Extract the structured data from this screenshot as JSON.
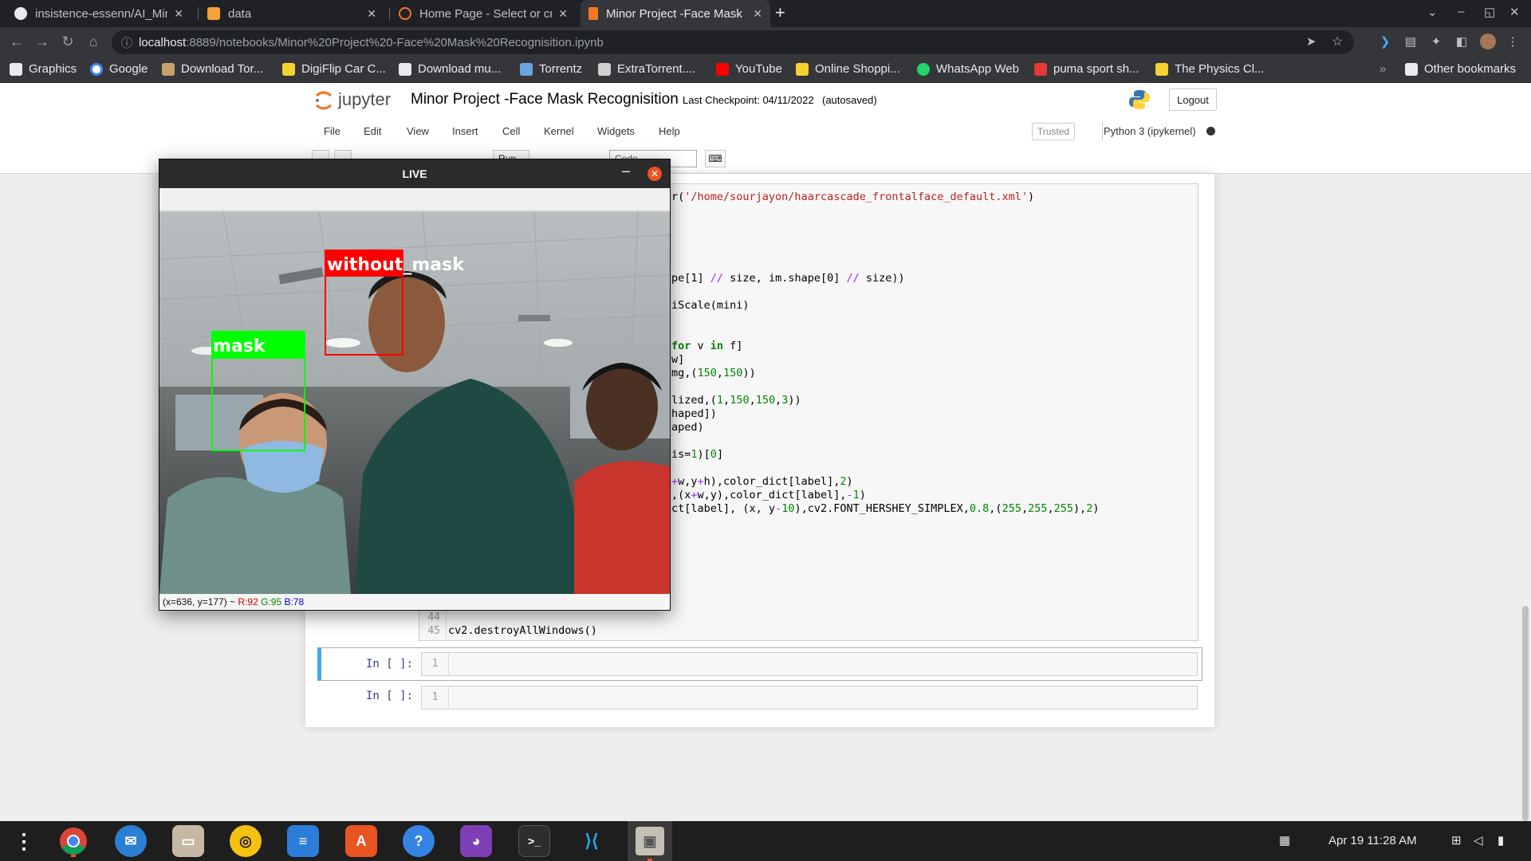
{
  "browser": {
    "tabs": [
      {
        "title": "insistence-essenn/AI_Min",
        "close": "✕"
      },
      {
        "title": "data",
        "close": "✕"
      },
      {
        "title": "Home Page - Select or cre",
        "close": "✕"
      },
      {
        "title": "Minor Project -Face Mask",
        "close": "✕",
        "active": true
      }
    ],
    "new_tab_label": "+",
    "url_host": "localhost",
    "url_path": ":8889/notebooks/Minor%20Project%20-Face%20Mask%20Recognisition.ipynb",
    "bookmarks": [
      {
        "label": "Graphics",
        "icon": "folder-icon"
      },
      {
        "label": "Google",
        "icon": "google-icon"
      },
      {
        "label": "Download Tor...",
        "icon": "shield-icon"
      },
      {
        "label": "DigiFlip Car C...",
        "icon": "bookmark-icon"
      },
      {
        "label": "Download mu...",
        "icon": "page-icon"
      },
      {
        "label": "Torrentz",
        "icon": "torrentz-icon"
      },
      {
        "label": "ExtraTorrent....",
        "icon": "page-icon"
      },
      {
        "label": "YouTube",
        "icon": "youtube-icon"
      },
      {
        "label": "Online Shoppi...",
        "icon": "bookmark-icon"
      },
      {
        "label": "WhatsApp Web",
        "icon": "whatsapp-icon"
      },
      {
        "label": "puma sport sh...",
        "icon": "page-icon"
      },
      {
        "label": "The Physics Cl...",
        "icon": "page-icon"
      }
    ],
    "bookmarks_overflow": "»",
    "other_bookmarks": "Other bookmarks"
  },
  "jupyter": {
    "logo_text": "jupyter",
    "notebook_title": "Minor Project -Face Mask Recognisition",
    "checkpoint": "Last Checkpoint: 04/11/2022",
    "autosaved": "(autosaved)",
    "logout": "Logout",
    "menu": [
      "File",
      "Edit",
      "View",
      "Insert",
      "Cell",
      "Kernel",
      "Widgets",
      "Help"
    ],
    "trusted": "Trusted",
    "kernel_name": "Python 3 (ipykernel)",
    "run_label": "Run",
    "cell_type": "Code"
  },
  "code": {
    "tail_line_numbers": [
      "44",
      "45"
    ],
    "last_line": "cv2.destroyAllWindows()",
    "empty_cells": [
      {
        "prompt": "In [ ]:",
        "line": "1"
      },
      {
        "prompt": "In [ ]:",
        "line": "1"
      }
    ]
  },
  "live_window": {
    "title": "LIVE",
    "minimize": "–",
    "close": "✕",
    "status_coords": "(x=636, y=177) ~",
    "status_r": "R:92",
    "status_g": "G:95",
    "status_b": "B:78",
    "labels": {
      "mask": "mask",
      "without_mask": "without_mask"
    },
    "colors": {
      "mask": "#00ff00",
      "without_mask": "#ff0000"
    }
  },
  "taskbar": {
    "apps": [
      {
        "name": "activities-icon",
        "glyph": "⋮"
      },
      {
        "name": "chrome-icon",
        "glyph": ""
      },
      {
        "name": "thunderbird-icon",
        "glyph": "✉"
      },
      {
        "name": "files-icon",
        "glyph": "▭"
      },
      {
        "name": "rhythmbox-icon",
        "glyph": "◎"
      },
      {
        "name": "writer-icon",
        "glyph": "≡"
      },
      {
        "name": "software-icon",
        "glyph": "A"
      },
      {
        "name": "help-icon",
        "glyph": "?"
      },
      {
        "name": "github-icon",
        "glyph": "◕"
      },
      {
        "name": "terminal-icon",
        "glyph": ">_"
      },
      {
        "name": "vscode-icon",
        "glyph": "⟩⟨"
      },
      {
        "name": "image-viewer-icon",
        "glyph": "▣"
      }
    ],
    "clock": "Apr 19  11:28 AM"
  }
}
